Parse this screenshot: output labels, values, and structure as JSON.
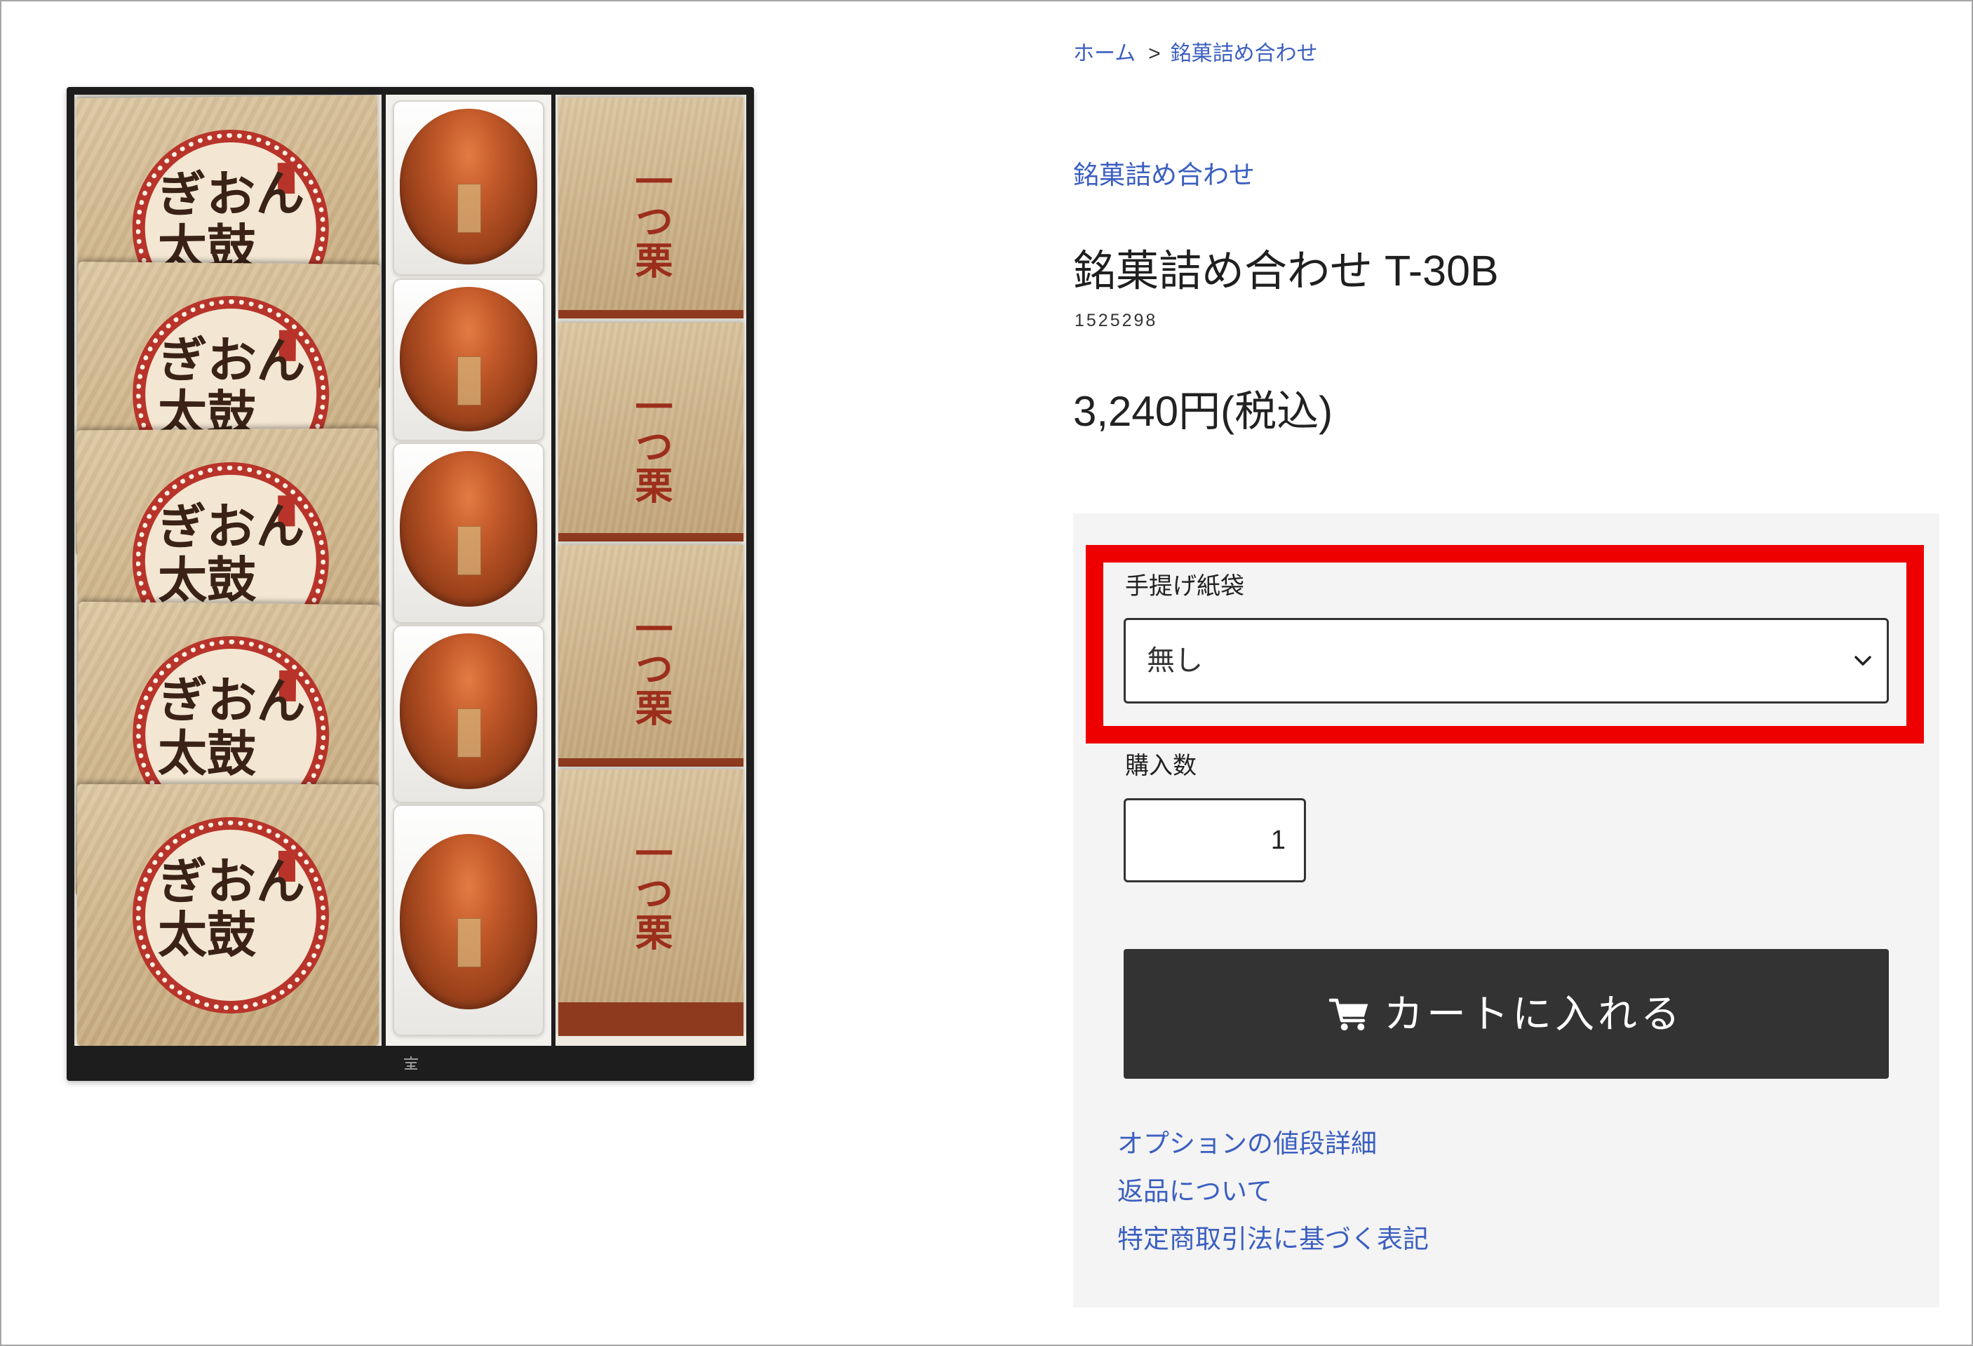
{
  "breadcrumb": {
    "home": "ホーム",
    "separator": ">",
    "current": "銘菓詰め合わせ"
  },
  "product": {
    "category": "銘菓詰め合わせ",
    "title": "銘菓詰め合わせ T-30B",
    "sku": "1525298",
    "price": "3,240円(税込)"
  },
  "product_image": {
    "gion_daiko_text": "ぎおん太鼓",
    "hitotsuguri_text": "一つ栗"
  },
  "options": {
    "bag_label": "手提げ紙袋",
    "bag_selected": "無し",
    "quantity_label": "購入数",
    "quantity_value": "1"
  },
  "cart_button": {
    "label": "カートに入れる",
    "icon": "cart-icon"
  },
  "links": [
    {
      "label": "オプションの値段詳細"
    },
    {
      "label": "返品について"
    },
    {
      "label": "特定商取引法に基づく表記"
    }
  ],
  "icons": {
    "select": "chevron-down-icon",
    "cart": "cart-icon",
    "box": "box-emblem-icon"
  },
  "colors": {
    "link": "#3b5fc0",
    "highlight_border": "#ee0000",
    "button_bg": "#333333",
    "panel_bg": "#f4f4f4"
  }
}
